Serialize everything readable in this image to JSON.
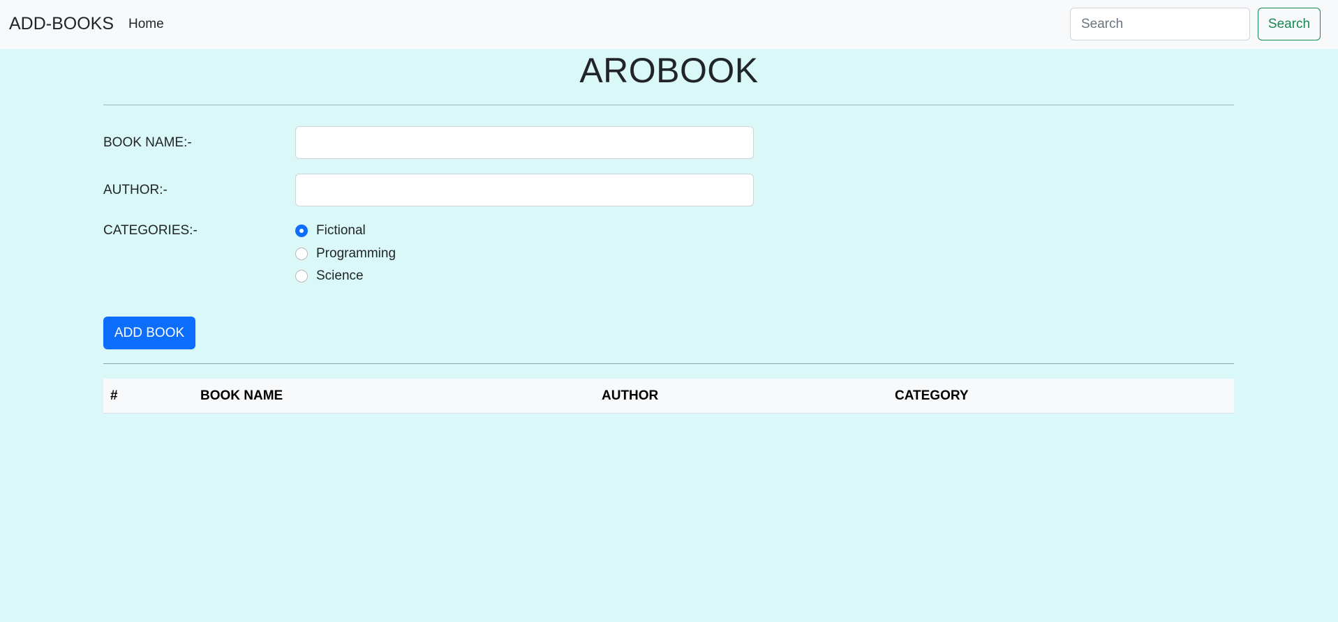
{
  "navbar": {
    "brand": "ADD-BOOKS",
    "home": "Home",
    "search_placeholder": "Search",
    "search_button": "Search"
  },
  "page": {
    "title": "AROBOOK"
  },
  "form": {
    "book_name_label": "BOOK NAME:-",
    "book_name_value": "",
    "author_label": "AUTHOR:-",
    "author_value": "",
    "categories_label": "CATEGORIES:-",
    "categories": [
      {
        "label": "Fictional",
        "checked": true
      },
      {
        "label": "Programming",
        "checked": false
      },
      {
        "label": "Science",
        "checked": false
      }
    ],
    "submit_label": "ADD BOOK"
  },
  "table": {
    "headers": [
      "#",
      "BOOK NAME",
      "AUTHOR",
      "CATEGORY"
    ],
    "rows": []
  },
  "colors": {
    "page_background": "#d9f8f7",
    "navbar_background": "#f8f9fa",
    "primary": "#0d6efd",
    "success": "#198754"
  }
}
